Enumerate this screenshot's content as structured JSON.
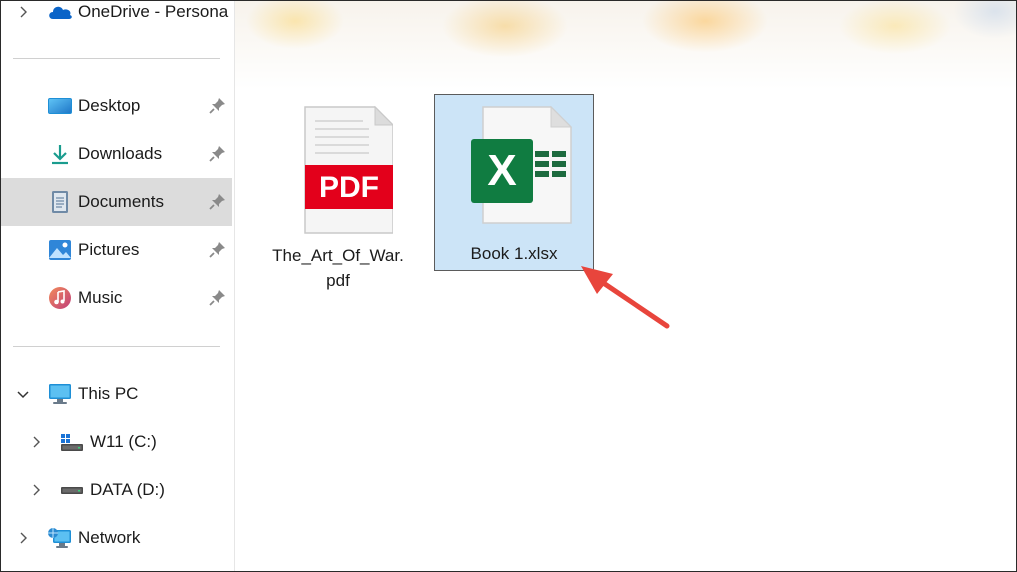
{
  "sidebar": {
    "onedrive": {
      "label": "OneDrive - Persona"
    },
    "quick_access": [
      {
        "label": "Desktop",
        "icon": "desktop-icon"
      },
      {
        "label": "Downloads",
        "icon": "downloads-icon"
      },
      {
        "label": "Documents",
        "icon": "documents-icon",
        "selected": true
      },
      {
        "label": "Pictures",
        "icon": "pictures-icon"
      },
      {
        "label": "Music",
        "icon": "music-icon"
      }
    ],
    "this_pc": {
      "label": "This PC"
    },
    "drives": [
      {
        "label": "W11 (C:)"
      },
      {
        "label": "DATA (D:)"
      }
    ],
    "network": {
      "label": "Network"
    }
  },
  "files": [
    {
      "line1": "The_Art_Of_War.",
      "line2": "pdf",
      "type": "pdf",
      "icon_text": "PDF"
    },
    {
      "line1": "Book 1.xlsx",
      "type": "xlsx",
      "icon_text": "X",
      "selected": true
    }
  ],
  "colors": {
    "selection": "#cce4f7",
    "sidebar_selected": "#dcdcdc",
    "pdf_red": "#e3001b",
    "excel_green": "#107c41",
    "arrow": "#e8453c"
  }
}
